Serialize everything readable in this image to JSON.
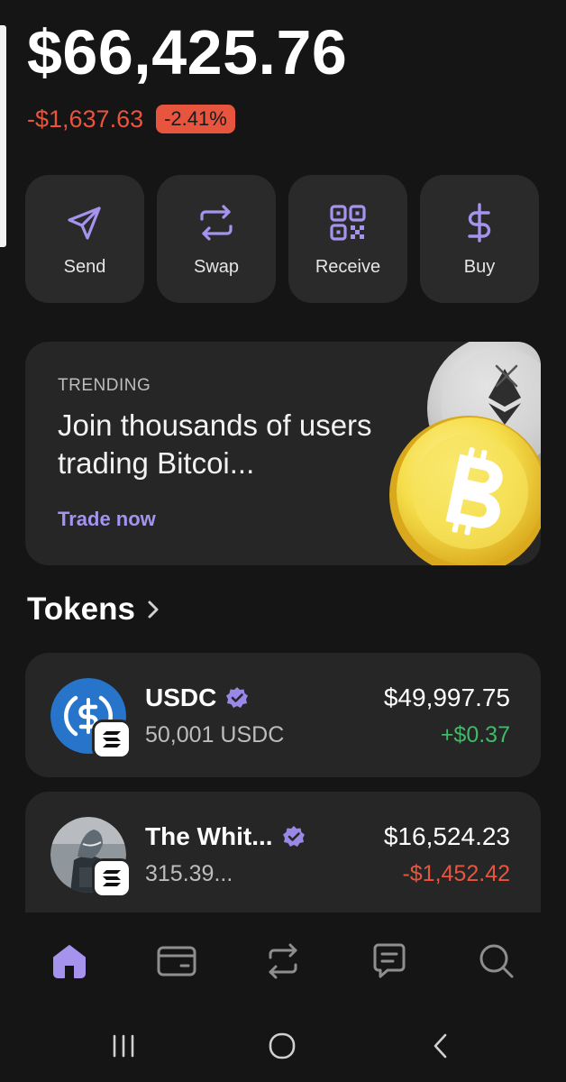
{
  "portfolio": {
    "balance": "$66,425.76",
    "change_amount": "-$1,637.63",
    "change_percent": "-2.41%"
  },
  "actions": [
    {
      "label": "Send",
      "icon": "send-icon"
    },
    {
      "label": "Swap",
      "icon": "swap-icon"
    },
    {
      "label": "Receive",
      "icon": "qr-code-icon"
    },
    {
      "label": "Buy",
      "icon": "dollar-icon"
    }
  ],
  "promo": {
    "tag": "TRENDING",
    "text": "Join thousands of users trading Bitcoi...",
    "cta": "Trade now",
    "icons": [
      "ethereum-coin-icon",
      "bitcoin-coin-icon",
      "close-icon"
    ]
  },
  "tokens_section": {
    "title": "Tokens"
  },
  "tokens": [
    {
      "name": "USDC",
      "amount": "50,001 USDC",
      "value": "$49,997.75",
      "change": "+$0.37",
      "verified": true,
      "icon": "usdc-icon"
    },
    {
      "name": "The Whit...",
      "amount": "315.39...",
      "value": "$16,524.23",
      "change": "-$1,452.42",
      "verified": true,
      "icon": "shark-avatar-icon"
    }
  ],
  "tabbar": [
    "home-icon",
    "wallet-card-icon",
    "swap-icon",
    "chat-icon",
    "search-icon"
  ],
  "system_nav": [
    "recent-apps-icon",
    "home-circle-icon",
    "back-icon"
  ],
  "colors": {
    "background": "#151515",
    "card": "#262626",
    "accent": "#a593ee",
    "negative": "#e8553f",
    "positive": "#42b86a"
  }
}
